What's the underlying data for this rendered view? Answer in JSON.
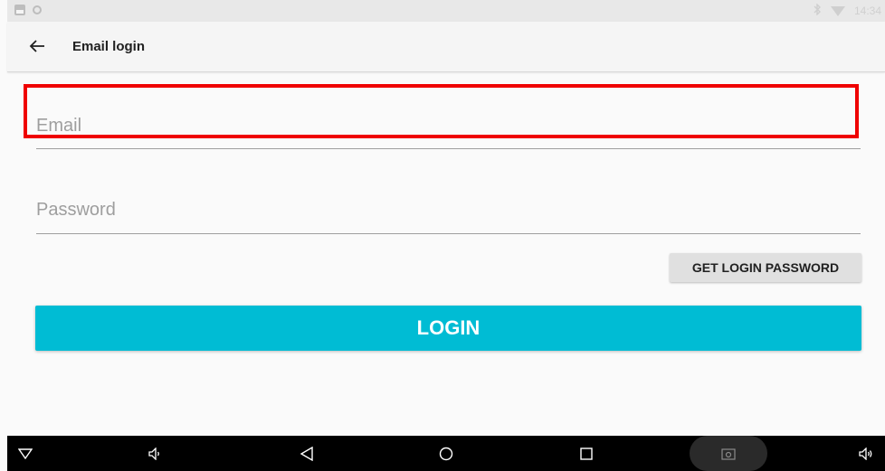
{
  "status_bar": {
    "time": "14:34",
    "icons": [
      "image-icon",
      "circle-icon",
      "bluetooth-icon",
      "wifi-icon"
    ]
  },
  "app_bar": {
    "title": "Email login",
    "back_icon": "arrow-left-icon"
  },
  "form": {
    "email": {
      "placeholder": "Email",
      "value": ""
    },
    "password": {
      "placeholder": "Password",
      "value": ""
    },
    "get_password_label": "GET LOGIN PASSWORD",
    "login_label": "LOGIN"
  },
  "highlight": {
    "target": "email-field",
    "color": "#ef0000"
  },
  "nav_bar": {
    "items": [
      "collapse-icon",
      "volume-down-icon",
      "back-icon",
      "home-icon",
      "recents-icon",
      "screenshot-icon",
      "volume-up-icon"
    ]
  },
  "colors": {
    "accent": "#00bcd4",
    "button_gray": "#e0e0e0",
    "background": "#fafafa"
  }
}
